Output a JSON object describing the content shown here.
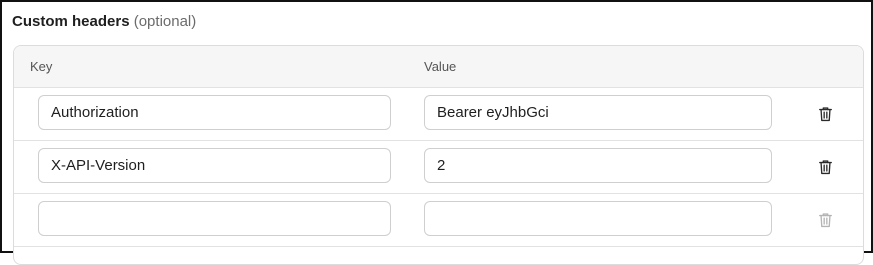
{
  "section": {
    "title": "Custom headers",
    "optional_label": "(optional)"
  },
  "columns": {
    "key": "Key",
    "value": "Value"
  },
  "rows": [
    {
      "key": "Authorization",
      "value": "Bearer eyJhbGci",
      "delete_icon": "trash-icon",
      "delete_enabled": true
    },
    {
      "key": "X-API-Version",
      "value": "2",
      "delete_icon": "trash-icon",
      "delete_enabled": true
    },
    {
      "key": "",
      "value": "",
      "delete_icon": "trash-icon",
      "delete_enabled": false
    }
  ],
  "colors": {
    "text": "#1f1f1f",
    "muted": "#6b6b6b",
    "border": "#dcdcdc",
    "header_bg": "#f6f6f6"
  }
}
